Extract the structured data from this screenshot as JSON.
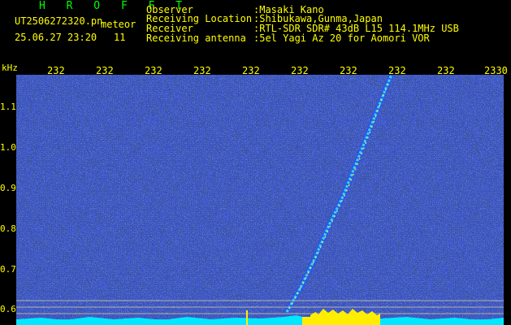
{
  "header": {
    "brand": "H R O F F T",
    "filename": "UT2506272320.pn",
    "suffix": "meteor",
    "timestamp": "25.06.27 23:20",
    "count": "11",
    "fields": [
      {
        "label": "Observer",
        "value": ":Masaki Kano"
      },
      {
        "label": "Receiving Location",
        "value": ":Shibukawa,Gunma,Japan"
      },
      {
        "label": "Receiver",
        "value": ":RTL-SDR SDR# 43dB L15 114.1MHz USB"
      },
      {
        "label": "Receiving antenna",
        "value": ":5el Yagi Az 20 for Aomori VOR"
      }
    ]
  },
  "axis": {
    "unit": "kHz",
    "time_ticks": [
      "232",
      "232",
      "232",
      "232",
      "232",
      "232",
      "232",
      "232",
      "232",
      "2330"
    ],
    "freq_ticks": [
      "1.1",
      "1.0",
      "0.9",
      "0.8",
      "0.7",
      "0.6"
    ]
  },
  "colors": {
    "background": "#000000",
    "label": "#ffff00",
    "brand": "#00ff00",
    "noise_floor": "#00e8ff",
    "echo": "#ffff00"
  }
}
